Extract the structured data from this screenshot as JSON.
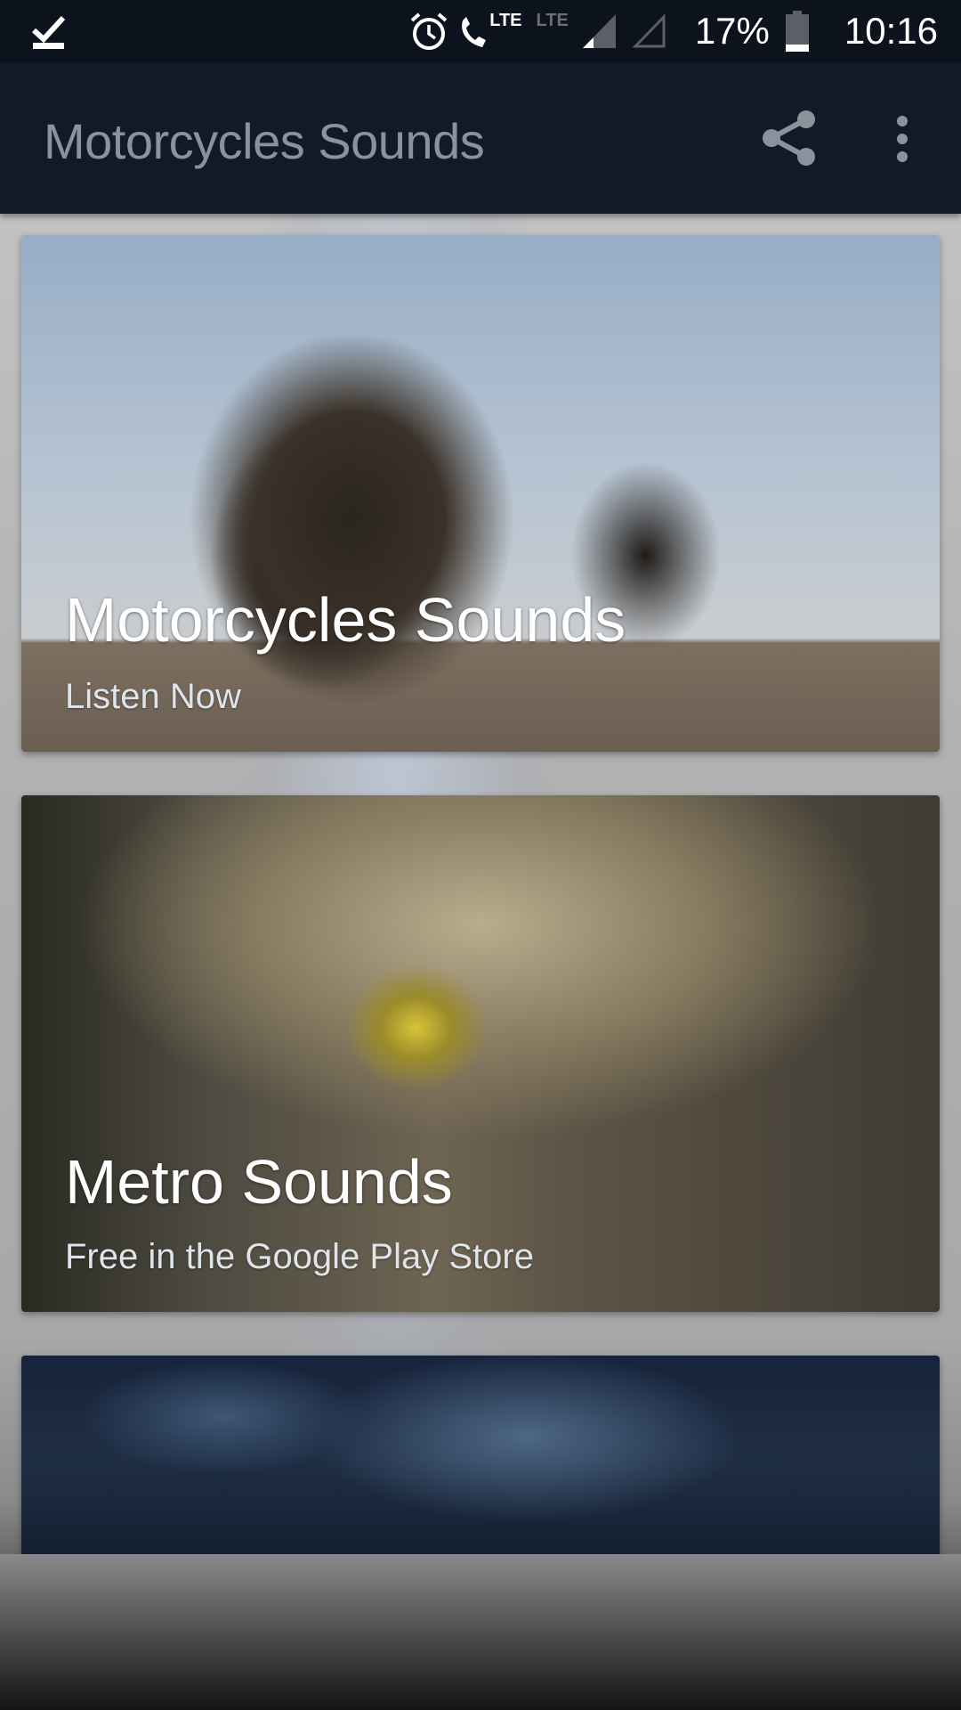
{
  "status_bar": {
    "left_icon": "download-done-icon",
    "icons": [
      "alarm-icon",
      "volte-call-icon",
      "lte-disabled-icon",
      "signal-icon",
      "signal-empty-icon",
      "battery-icon"
    ],
    "volte_label": "LTE",
    "lte_disabled_label": "LTE",
    "battery": "17%",
    "time": "10:16"
  },
  "app_bar": {
    "title": "Motorcycles Sounds",
    "actions": [
      "share-icon",
      "more-vert-icon"
    ]
  },
  "cards": [
    {
      "title": "Motorcycles Sounds",
      "subtitle": "Listen Now",
      "image": "motorcycle-photo"
    },
    {
      "title": "Metro Sounds",
      "subtitle": "Free in the Google Play Store",
      "image": "metro-tunnel-photo"
    },
    {
      "title": "",
      "subtitle": "",
      "image": "cloudy-sky-photo"
    }
  ]
}
